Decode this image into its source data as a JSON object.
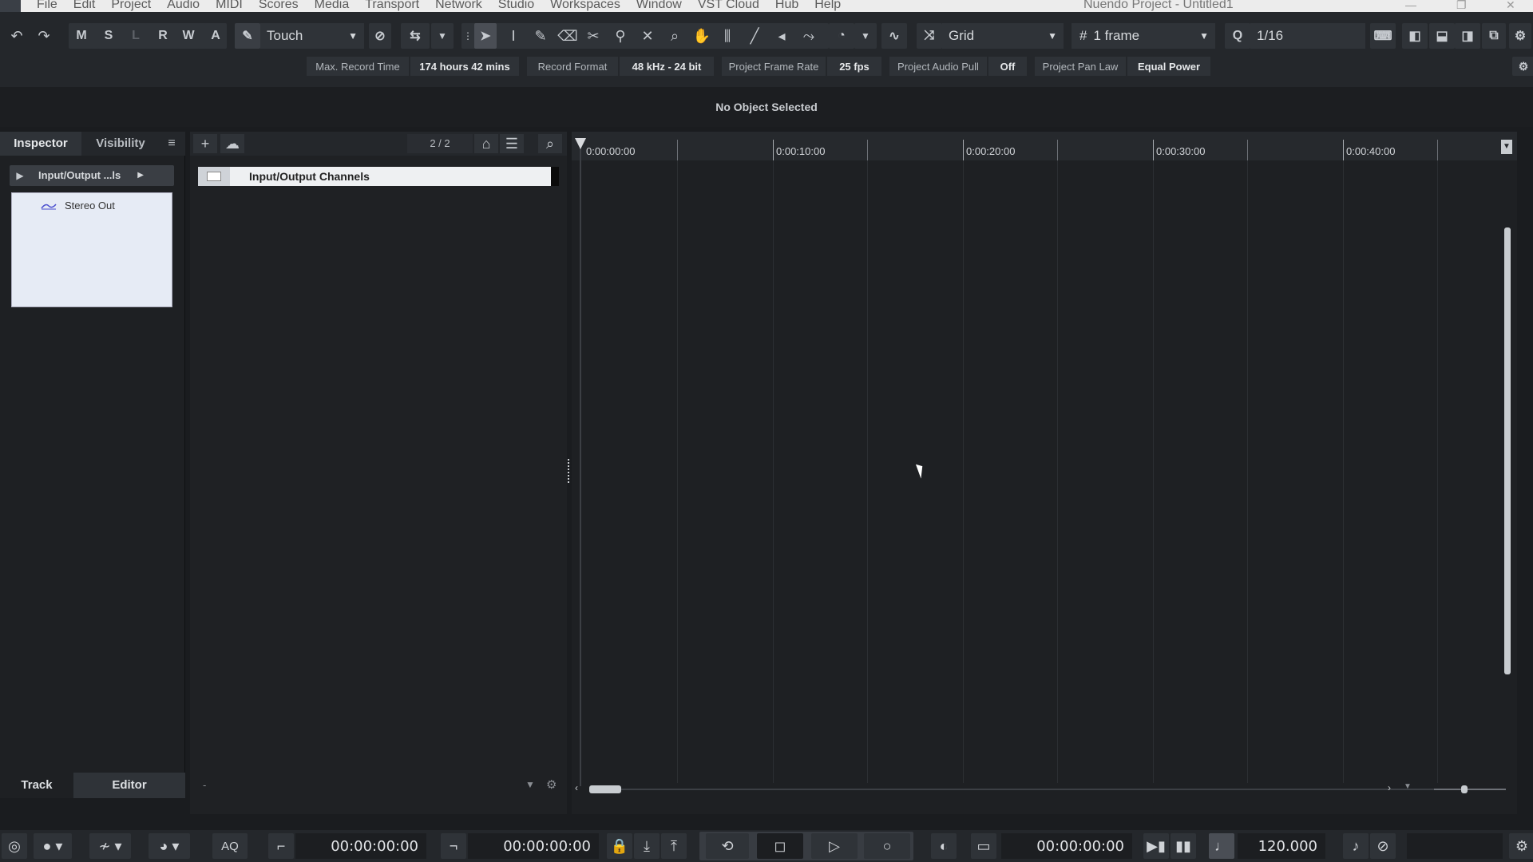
{
  "menubar": {
    "items": [
      "File",
      "Edit",
      "Project",
      "Audio",
      "MIDI",
      "Scores",
      "Media",
      "Transport",
      "Network",
      "Studio",
      "Workspaces",
      "Window",
      "VST Cloud",
      "Hub",
      "Help"
    ],
    "window_title": "Nuendo Project - Untitled1"
  },
  "toolbar": {
    "mute_label": "M",
    "solo_label": "S",
    "listen_label": "L",
    "read_label": "R",
    "write_label": "W",
    "a_label": "A",
    "automation_mode": "Touch",
    "snap_type": "Grid",
    "grid_value": "1 frame",
    "quantize_value": "1/16"
  },
  "infoline": {
    "max_record_time_label": "Max. Record Time",
    "max_record_time_value": "174 hours 42 mins",
    "record_format_label": "Record Format",
    "record_format_value": "48 kHz - 24 bit",
    "frame_rate_label": "Project Frame Rate",
    "frame_rate_value": "25 fps",
    "audio_pull_label": "Project Audio Pull",
    "audio_pull_value": "Off",
    "pan_law_label": "Project Pan Law",
    "pan_law_value": "Equal Power"
  },
  "statusline": {
    "message": "No Object Selected"
  },
  "inspector": {
    "tab_inspector": "Inspector",
    "tab_visibility": "Visibility",
    "header_label": "Input/Output ...ls",
    "list_item": "Stereo Out",
    "bottom_tab_track": "Track",
    "bottom_tab_editor": "Editor"
  },
  "tracklist": {
    "count": "2 / 2",
    "track_name": "Input/Output Channels",
    "footer_minus": "-"
  },
  "ruler": {
    "labels": [
      "0:00:00:00",
      "0:00:10:00",
      "0:00:20:00",
      "0:00:30:00",
      "0:00:40:00"
    ]
  },
  "transport": {
    "aq_label": "AQ",
    "left_locator": "00:00:00:00",
    "right_locator": "00:00:00:00",
    "primary_time": "00:00:00:00",
    "tempo": "120.000"
  }
}
